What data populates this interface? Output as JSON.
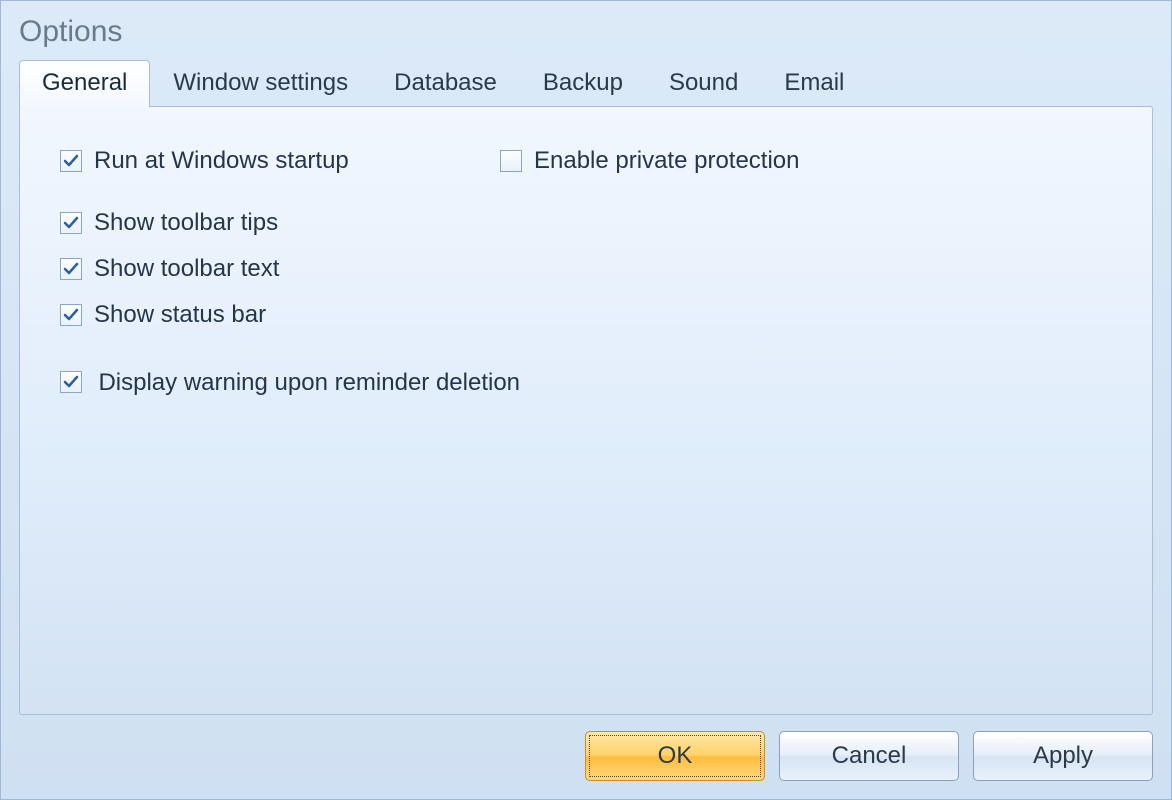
{
  "window": {
    "title": "Options"
  },
  "tabs": [
    {
      "label": "General",
      "active": true
    },
    {
      "label": "Window settings",
      "active": false
    },
    {
      "label": "Database",
      "active": false
    },
    {
      "label": "Backup",
      "active": false
    },
    {
      "label": "Sound",
      "active": false
    },
    {
      "label": "Email",
      "active": false
    }
  ],
  "options": {
    "run_startup": {
      "label": "Run at Windows startup",
      "checked": true
    },
    "private_prot": {
      "label": "Enable private protection",
      "checked": false
    },
    "toolbar_tips": {
      "label": "Show toolbar tips",
      "checked": true
    },
    "toolbar_text": {
      "label": "Show toolbar text",
      "checked": true
    },
    "status_bar": {
      "label": "Show status bar",
      "checked": true
    },
    "warn_delete": {
      "label": "Display warning upon reminder deletion",
      "checked": true
    }
  },
  "buttons": {
    "ok": "OK",
    "cancel": "Cancel",
    "apply": "Apply"
  }
}
